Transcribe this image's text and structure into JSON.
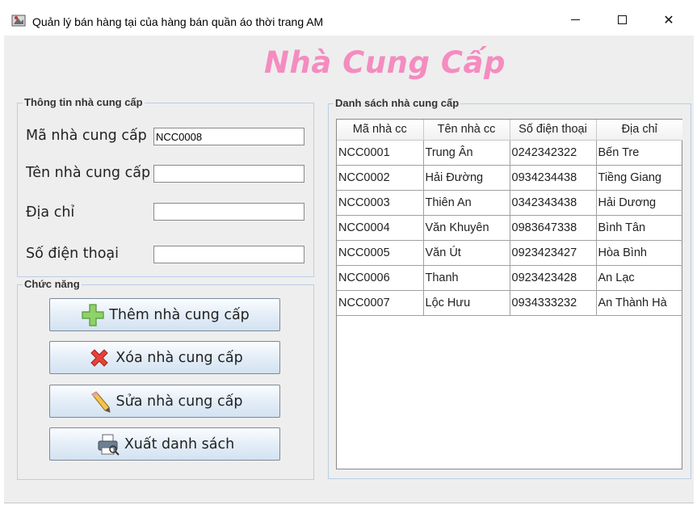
{
  "window": {
    "title": "Quản lý bán hàng tại của hàng bán quần áo thời trang AM",
    "close_glyph": "✕"
  },
  "heading": "Nhà Cung Cấp",
  "info_panel": {
    "title": "Thông tin nhà cung cấp",
    "fields": [
      {
        "label": "Mã nhà cung cấp",
        "value": "NCC0008"
      },
      {
        "label": "Tên nhà cung cấp",
        "value": ""
      },
      {
        "label": "Địa chỉ",
        "value": ""
      },
      {
        "label": "Số điện thoại",
        "value": ""
      }
    ]
  },
  "function_panel": {
    "title": "Chức năng",
    "buttons": [
      {
        "label": "Thêm nhà cung cấp",
        "icon": "plus-icon"
      },
      {
        "label": "Xóa nhà cung cấp",
        "icon": "delete-x-icon"
      },
      {
        "label": "Sửa nhà cung cấp",
        "icon": "pencil-icon"
      },
      {
        "label": "Xuất danh sách",
        "icon": "printer-icon"
      }
    ]
  },
  "list_panel": {
    "title": "Danh sách nhà cung cấp",
    "columns": [
      "Mã nhà cc",
      "Tên nhà cc",
      "Số điện thoại",
      "Địa chỉ"
    ],
    "rows": [
      [
        "NCC0001",
        "Trung Ân",
        "0242342322",
        "Bến Tre"
      ],
      [
        "NCC0002",
        "Hải Đường",
        "0934234438",
        "Tiềng Giang"
      ],
      [
        "NCC0003",
        "Thiên An",
        "0342343438",
        "Hải Dương"
      ],
      [
        "NCC0004",
        "Văn Khuyên",
        "0983647338",
        "Bình Tân"
      ],
      [
        "NCC0005",
        "Văn Út",
        "0923423427",
        "Hòa Bình"
      ],
      [
        "NCC0006",
        "Thanh",
        "0923423428",
        "An Lạc"
      ],
      [
        "NCC0007",
        "Lộc Hưu",
        "0934333232",
        "An Thành Hà"
      ]
    ]
  },
  "colors": {
    "heading": "#f48cc0",
    "panel_border": "#b8cfe5",
    "frame": "#eeeeee"
  }
}
